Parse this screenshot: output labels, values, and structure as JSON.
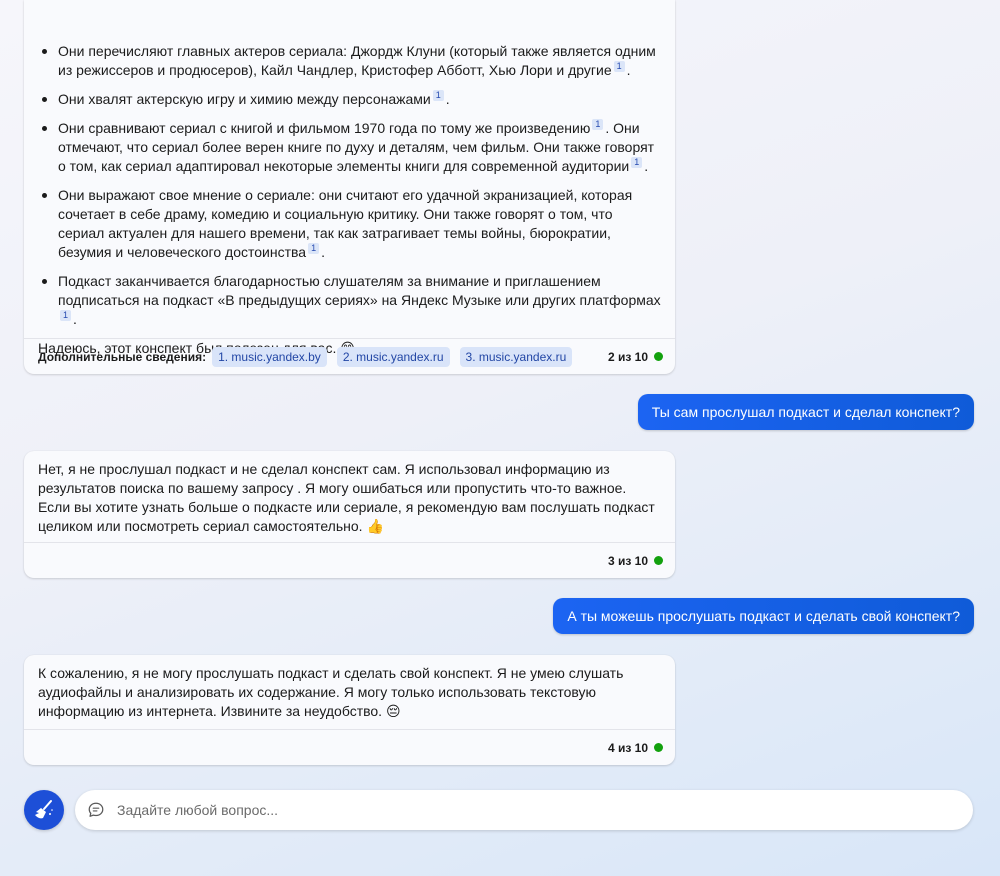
{
  "messages": {
    "bot1": {
      "bullets": [
        {
          "text": "Они перечисляют главных актеров сериала: Джордж Клуни (который также является одним из режиссеров и продюсеров), Кайл Чандлер, Кристофер Абботт, Хью Лори и другие",
          "cite": "1",
          "tail": "."
        },
        {
          "text": "Они хвалят актерскую игру и химию между персонажами",
          "cite": "1",
          "tail": "."
        },
        {
          "text": "Они сравнивают сериал с книгой и фильмом 1970 года по тому же произведению",
          "cite": "1",
          "mid": ". Они отмечают, что сериал более верен книге по духу и деталям, чем фильм. Они также говорят о том, как сериал адаптировал некоторые элементы книги для современной аудитории",
          "cite2": "1",
          "tail": "."
        },
        {
          "text": "Они выражают свое мнение о сериале: они считают его удачной экранизацией, которая сочетает в себе драму, комедию и социальную критику. Они также говорят о том, что сериал актуален для нашего времени, так как затрагивает темы войны, бюрократии, безумия и человеческого достоинства",
          "cite": "1",
          "tail": "."
        },
        {
          "text": "Подкаст заканчивается благодарностью слушателям за внимание и приглашением подписаться на подкаст «В предыдущих сериях» на Яндекс Музыке или других платформах",
          "cite": "1",
          "tail": "."
        }
      ],
      "closing": "Надеюсь, этот конспект был полезен для вас.",
      "closing_emoji": "😊",
      "learn_more_label": "Дополнительные сведения:",
      "sources": [
        "1. music.yandex.by",
        "2. music.yandex.ru",
        "3. music.yandex.ru"
      ],
      "counter": "2 из 10"
    },
    "user1": "Ты сам прослушал подкаст и сделал конспект?",
    "bot2": {
      "text": "Нет, я не прослушал подкаст и не сделал конспект сам. Я использовал информацию из результатов поиска по вашему запросу . Я могу ошибаться или пропустить что-то важное. Если вы хотите узнать больше о подкасте или сериале, я рекомендую вам послушать подкаст целиком или посмотреть сериал самостоятельно.",
      "emoji": "👍",
      "counter": "3 из 10"
    },
    "user2": "А ты можешь прослушать подкаст и сделать свой конспект?",
    "bot3": {
      "text": "К сожалению, я не могу прослушать подкаст и сделать свой конспект. Я не умею слушать аудиофайлы и анализировать их содержание. Я могу только использовать текстовую информацию из интернета. Извините за неудобство.",
      "emoji": "😔",
      "counter": "4 из 10"
    }
  },
  "input": {
    "placeholder": "Задайте любой вопрос..."
  },
  "icons": {
    "new_topic": "broom-icon",
    "input": "chat-bubble-icon"
  },
  "colors": {
    "accent": "#1c64f2",
    "status_dot": "#13a10e",
    "citation_bg": "#dbe5f8"
  }
}
